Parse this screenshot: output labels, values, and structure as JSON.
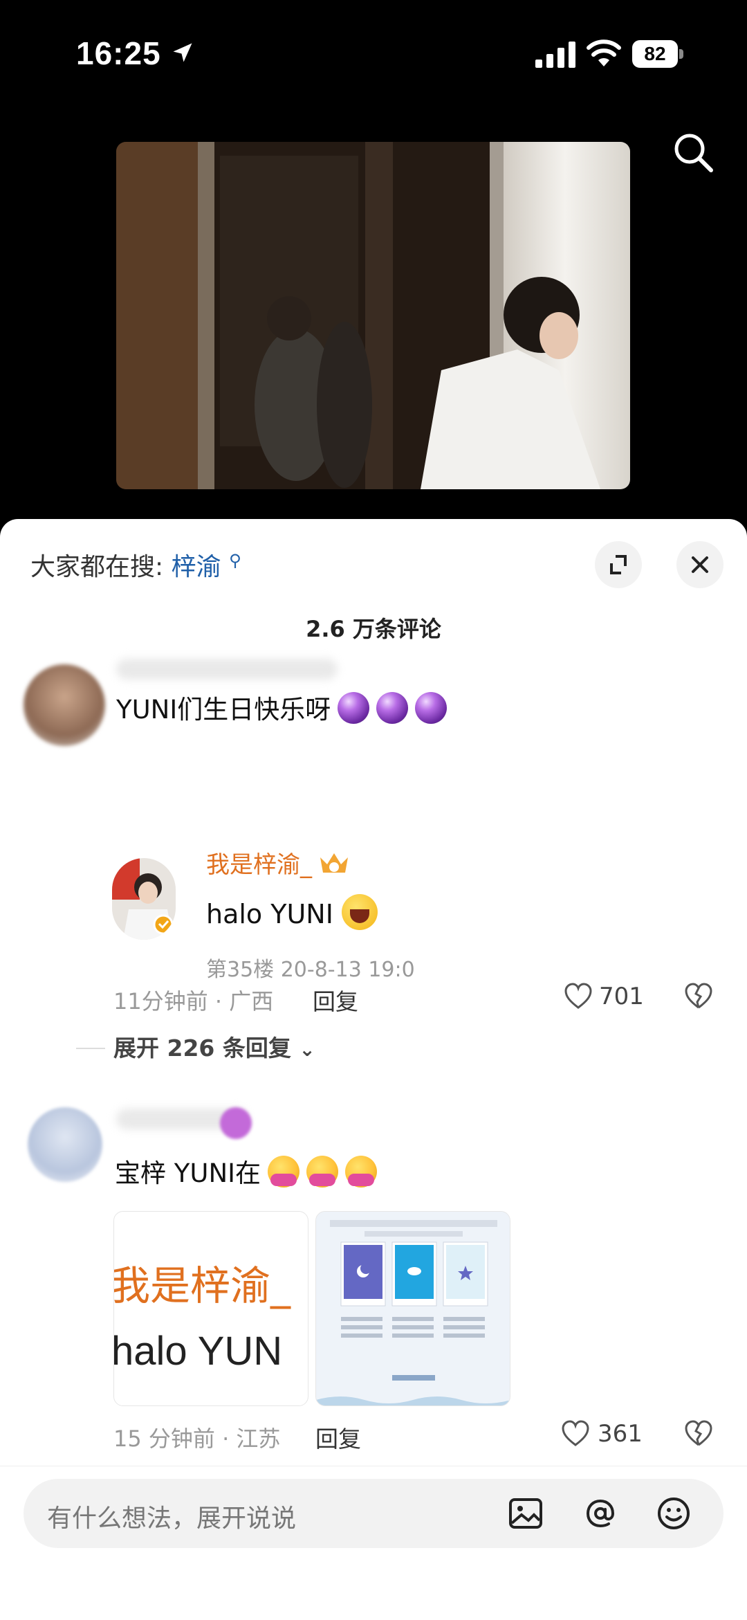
{
  "status_bar": {
    "time": "16:25",
    "battery": "82"
  },
  "sheet": {
    "hot_search_prefix": "大家都在搜:",
    "hot_search_keyword": "梓渝",
    "comment_count": "2.6 万条评论"
  },
  "comments": [
    {
      "text": "YUNI们生日快乐呀",
      "emoji": [
        "purple-crystal-ball",
        "purple-crystal-ball",
        "purple-crystal-ball"
      ],
      "quote": {
        "name": "我是梓渝_",
        "text": "halo YUNI",
        "meta": "第35楼 20-8-13 19:0"
      },
      "time_location": "11分钟前 · 广西",
      "reply_label": "回复",
      "likes": "701",
      "expand_replies": "展开 226 条回复"
    },
    {
      "text": "宝梓  YUNI在",
      "emoji": [
        "hugging-face",
        "hugging-face",
        "hugging-face"
      ],
      "thumb_text_line1": "我是梓渝_",
      "thumb_text_line2": "halo YUN",
      "time_location": "15 分钟前 · 江苏",
      "reply_label": "回复",
      "likes": "361"
    }
  ],
  "input": {
    "placeholder": "有什么想法，展开说说"
  },
  "colors": {
    "keyword_blue": "#1f5fa8",
    "quote_name_orange": "#e0701f"
  }
}
